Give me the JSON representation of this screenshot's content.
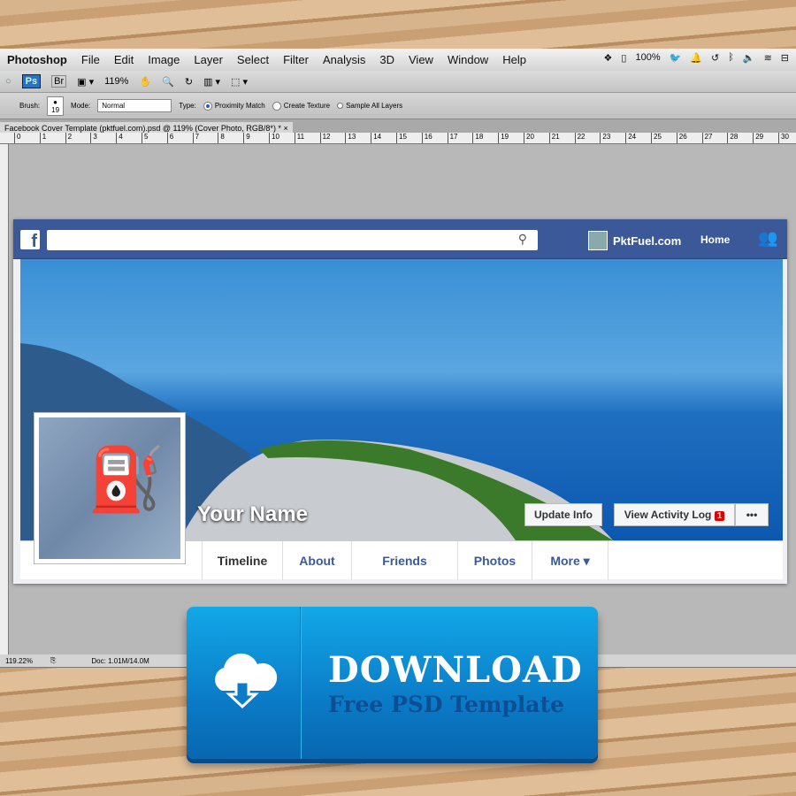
{
  "menubar": {
    "app": "Photoshop",
    "items": [
      "File",
      "Edit",
      "Image",
      "Layer",
      "Select",
      "Filter",
      "Analysis",
      "3D",
      "View",
      "Window",
      "Help"
    ],
    "battery": "100%"
  },
  "toolbar": {
    "ps": "Ps",
    "br": "Br",
    "zoom": "119%"
  },
  "options": {
    "brush_label": "Brush:",
    "brush_size": "19",
    "mode_label": "Mode:",
    "mode_value": "Normal",
    "type_label": "Type:",
    "proximity": "Proximity Match",
    "texture": "Create Texture",
    "sample": "Sample All Layers"
  },
  "doc_tab": {
    "title": "Facebook Cover Template (pktfuel.com).psd @ 119% (Cover Photo, RGB/8*) *",
    "close": "×"
  },
  "ruler": [
    "0",
    "1",
    "2",
    "3",
    "4",
    "5",
    "6",
    "7",
    "8",
    "9",
    "10",
    "11",
    "12",
    "13",
    "14",
    "15",
    "16",
    "17",
    "18",
    "19",
    "20",
    "21",
    "22",
    "23",
    "24",
    "25",
    "26",
    "27",
    "28",
    "29",
    "30"
  ],
  "statusbar": {
    "zoom": "119.22%",
    "doc": "Doc: 1.01M/14.0M"
  },
  "facebook": {
    "logo": "f",
    "site": "PktFuel.com",
    "home": "Home",
    "name": "Your Name",
    "update": "Update Info",
    "activity": "View Activity Log",
    "activity_badge": "1",
    "more_dots": "•••",
    "nav": [
      "Timeline",
      "About",
      "Friends",
      "Photos",
      "More ▾"
    ],
    "brand": "#3b5998"
  },
  "download": {
    "title": "DOWNLOAD",
    "subtitle": "Free PSD Template"
  }
}
